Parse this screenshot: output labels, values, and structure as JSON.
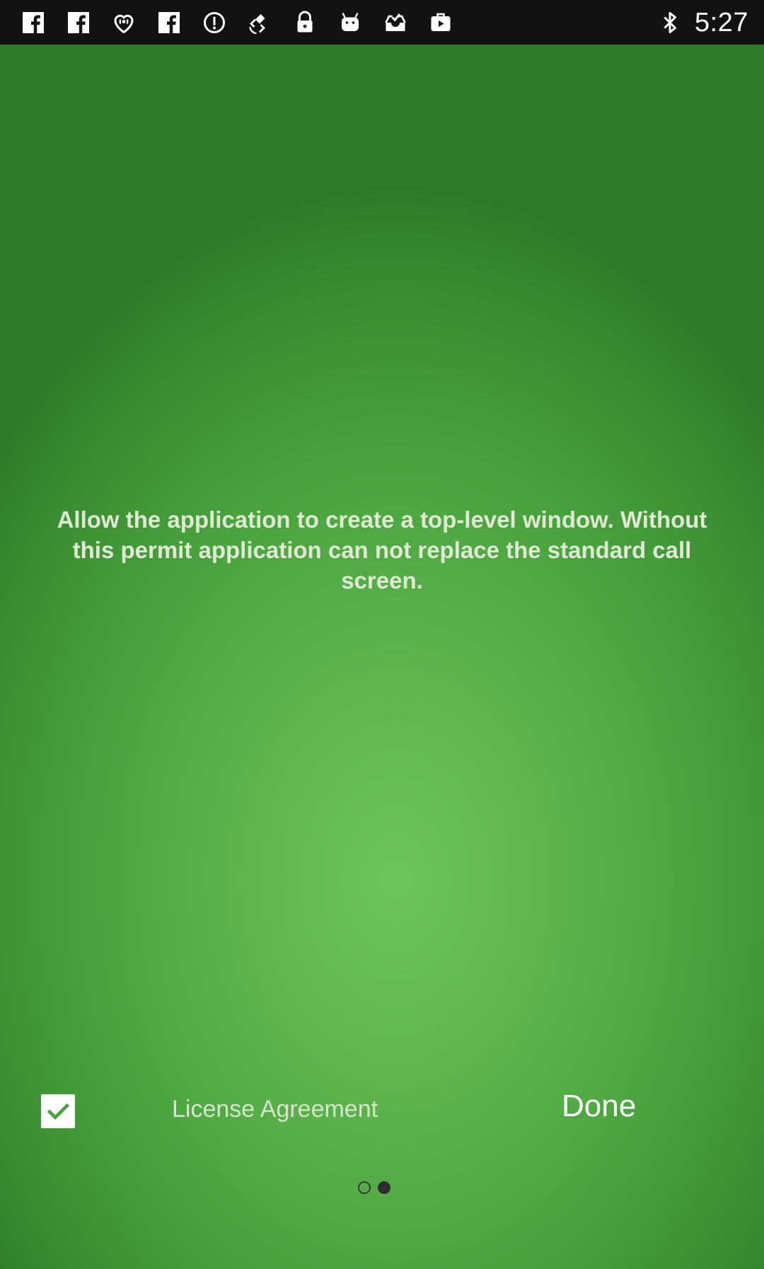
{
  "status_bar": {
    "time": "5:27",
    "left_icons": [
      "facebook-icon",
      "facebook-icon",
      "iheartradio-icon",
      "facebook-icon",
      "info-circle-icon",
      "fake-gps-icon",
      "lock-icon",
      "android-icon",
      "inbox-check-icon",
      "briefcase-play-icon"
    ],
    "right_icons": [
      "bluetooth-icon"
    ],
    "background_color": "#121212"
  },
  "permission": {
    "message": "Allow the application to create a top-level window. Without this permit application can not replace the standard call screen."
  },
  "footer": {
    "checkbox_checked": true,
    "license_label": "License Agreement",
    "done_label": "Done"
  },
  "pager": {
    "page_count": 2,
    "current_page": 2
  },
  "colors": {
    "background_center": "#6cc55a",
    "background_edge": "#2f7a2a",
    "message_text": "#dfe9d4"
  }
}
